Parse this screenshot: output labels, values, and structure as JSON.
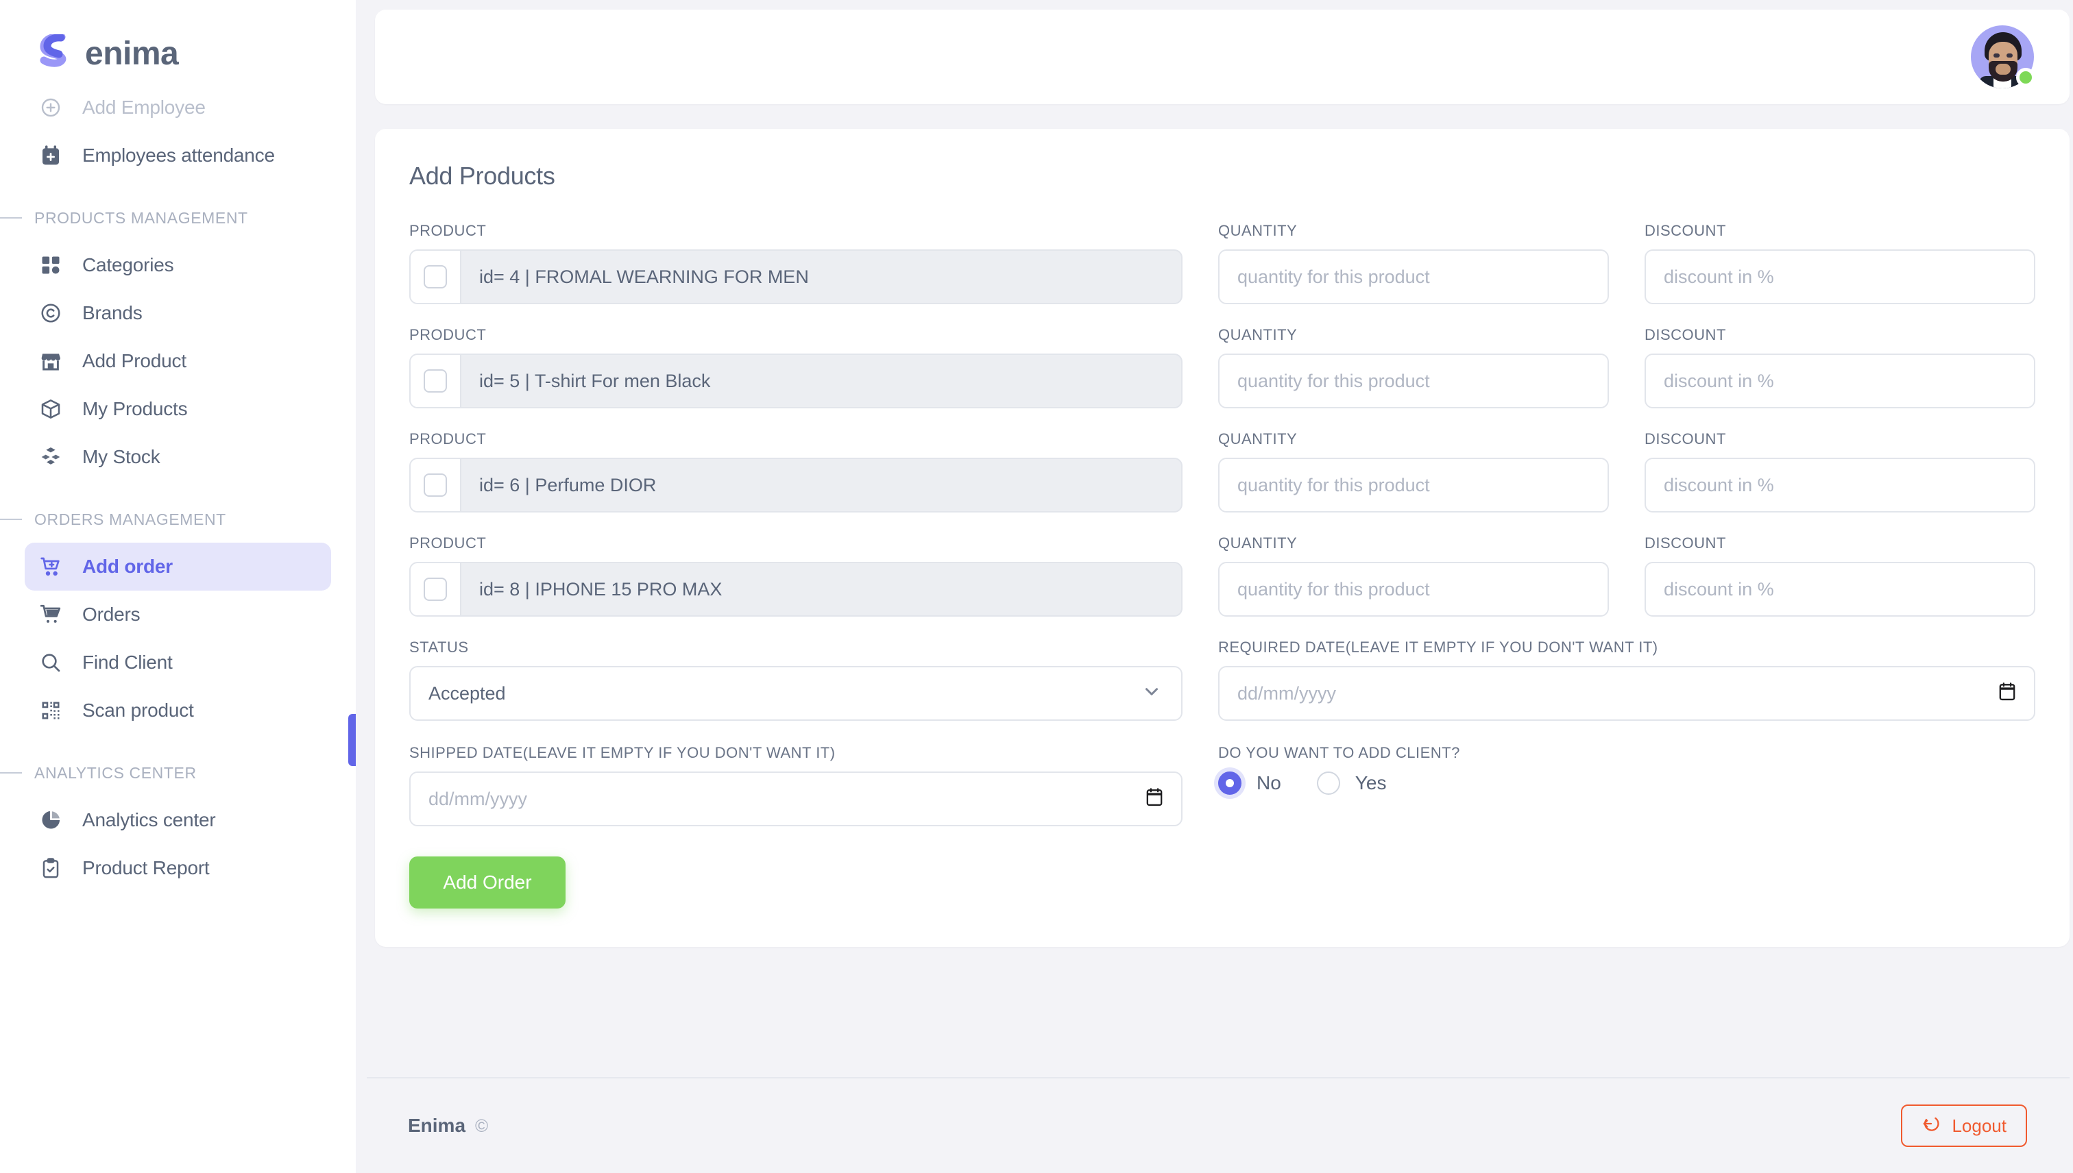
{
  "brand": {
    "name": "enima",
    "logo_icon": "s-logo-icon"
  },
  "sidebar": {
    "top_items": [
      {
        "label": "Add Employee",
        "icon": "plus-circle-icon",
        "muted": true,
        "active": false
      },
      {
        "label": "Employees attendance",
        "icon": "calendar-plus-icon",
        "muted": false,
        "active": false
      }
    ],
    "sections": [
      {
        "title": "PRODUCTS MANAGEMENT",
        "items": [
          {
            "label": "Categories",
            "icon": "grid-icon",
            "active": false
          },
          {
            "label": "Brands",
            "icon": "copyright-icon",
            "active": false
          },
          {
            "label": "Add Product",
            "icon": "store-icon",
            "active": false
          },
          {
            "label": "My Products",
            "icon": "box-icon",
            "active": false
          },
          {
            "label": "My Stock",
            "icon": "boxes-icon",
            "active": false
          }
        ]
      },
      {
        "title": "ORDERS MANAGEMENT",
        "items": [
          {
            "label": "Add order",
            "icon": "cart-plus-icon",
            "active": true
          },
          {
            "label": "Orders",
            "icon": "cart-icon",
            "active": false
          },
          {
            "label": "Find Client",
            "icon": "search-icon",
            "active": false
          },
          {
            "label": "Scan product",
            "icon": "qr-code-icon",
            "active": false
          }
        ]
      },
      {
        "title": "ANALYTICS CENTER",
        "items": [
          {
            "label": "Analytics center",
            "icon": "pie-chart-icon",
            "active": false
          },
          {
            "label": "Product Report",
            "icon": "clipboard-check-icon",
            "active": false
          }
        ]
      }
    ]
  },
  "topbar": {
    "avatar_icon": "user-avatar",
    "status": "online"
  },
  "main": {
    "card_title": "Add Products",
    "labels": {
      "product": "PRODUCT",
      "quantity": "QUANTITY",
      "discount": "DISCOUNT",
      "status": "STATUS",
      "required_date": "REQUIRED DATE(LEAVE IT EMPTY IF YOU DON'T WANT IT)",
      "shipped_date": "SHIPPED DATE(LEAVE IT EMPTY IF YOU DON'T WANT IT)",
      "add_client": "DO YOU WANT TO ADD CLIENT?"
    },
    "placeholders": {
      "quantity": "quantity for this product",
      "discount": "discount in %",
      "date": "dd/mm/yyyy"
    },
    "products": [
      {
        "text": "id= 4 | FROMAL WEARNING FOR MEN",
        "checked": false,
        "quantity": "",
        "discount": ""
      },
      {
        "text": "id= 5 | T-shirt For men Black",
        "checked": false,
        "quantity": "",
        "discount": ""
      },
      {
        "text": "id= 6 | Perfume DIOR",
        "checked": false,
        "quantity": "",
        "discount": ""
      },
      {
        "text": "id= 8 | IPHONE 15 PRO MAX",
        "checked": false,
        "quantity": "",
        "discount": ""
      }
    ],
    "status_value": "Accepted",
    "status_options": [
      "Accepted"
    ],
    "required_date_value": "",
    "shipped_date_value": "",
    "add_client": {
      "selected": "No",
      "options": [
        "No",
        "Yes"
      ]
    },
    "submit_label": "Add Order"
  },
  "footer": {
    "brand": "Enima",
    "copyright": "©",
    "logout_label": "Logout",
    "logout_icon": "logout-icon"
  },
  "colors": {
    "accent": "#6165e8",
    "accent_soft": "#e5e5fb",
    "text": "#5a6579",
    "muted": "#b9bfcc",
    "success": "#7fd45c",
    "danger": "#f05a2f",
    "page_bg": "#f3f3f7"
  }
}
